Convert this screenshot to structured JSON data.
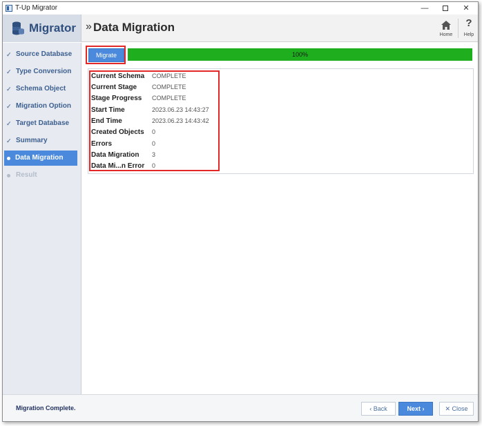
{
  "window": {
    "title": "T-Up Migrator",
    "controls": {
      "minimize": "—",
      "close": "✕"
    }
  },
  "header": {
    "app_name": "Migrator",
    "breadcrumb_chevron": "»",
    "page_title": "Data Migration",
    "home_label": "Home",
    "help_label": "Help",
    "help_glyph": "?"
  },
  "sidebar": {
    "items": [
      {
        "label": "Source Database",
        "state": "done",
        "marker": "✓"
      },
      {
        "label": "Type Conversion",
        "state": "done",
        "marker": "✓"
      },
      {
        "label": "Schema Object",
        "state": "done",
        "marker": "✓"
      },
      {
        "label": "Migration Option",
        "state": "done",
        "marker": "✓"
      },
      {
        "label": "Target Database",
        "state": "done",
        "marker": "✓"
      },
      {
        "label": "Summary",
        "state": "done",
        "marker": "✓"
      },
      {
        "label": "Data Migration",
        "state": "active"
      },
      {
        "label": "Result",
        "state": "disabled"
      }
    ]
  },
  "main": {
    "migrate_button": "Migrate",
    "progress": {
      "percent": 100,
      "label": "100%"
    },
    "info": [
      {
        "key": "Current Schema",
        "value": "COMPLETE"
      },
      {
        "key": "Current Stage",
        "value": "COMPLETE"
      },
      {
        "key": "Stage Progress",
        "value": "COMPLETE"
      },
      {
        "key": "Start Time",
        "value": "2023.06.23 14:43:27"
      },
      {
        "key": "End Time",
        "value": "2023.06.23 14:43:42"
      },
      {
        "key": "Created Objects",
        "value": "0"
      },
      {
        "key": "Errors",
        "value": "0"
      },
      {
        "key": "Data Migration",
        "value": "3"
      },
      {
        "key": "Data Mi...n Error",
        "value": "0"
      }
    ]
  },
  "footer": {
    "status": "Migration Complete.",
    "back": "‹ Back",
    "next": "Next ›",
    "close": "✕ Close"
  },
  "colors": {
    "accent": "#4a89dc",
    "progress": "#1eae1e",
    "highlight": "#e32626",
    "brand": "#2f4f7f"
  }
}
